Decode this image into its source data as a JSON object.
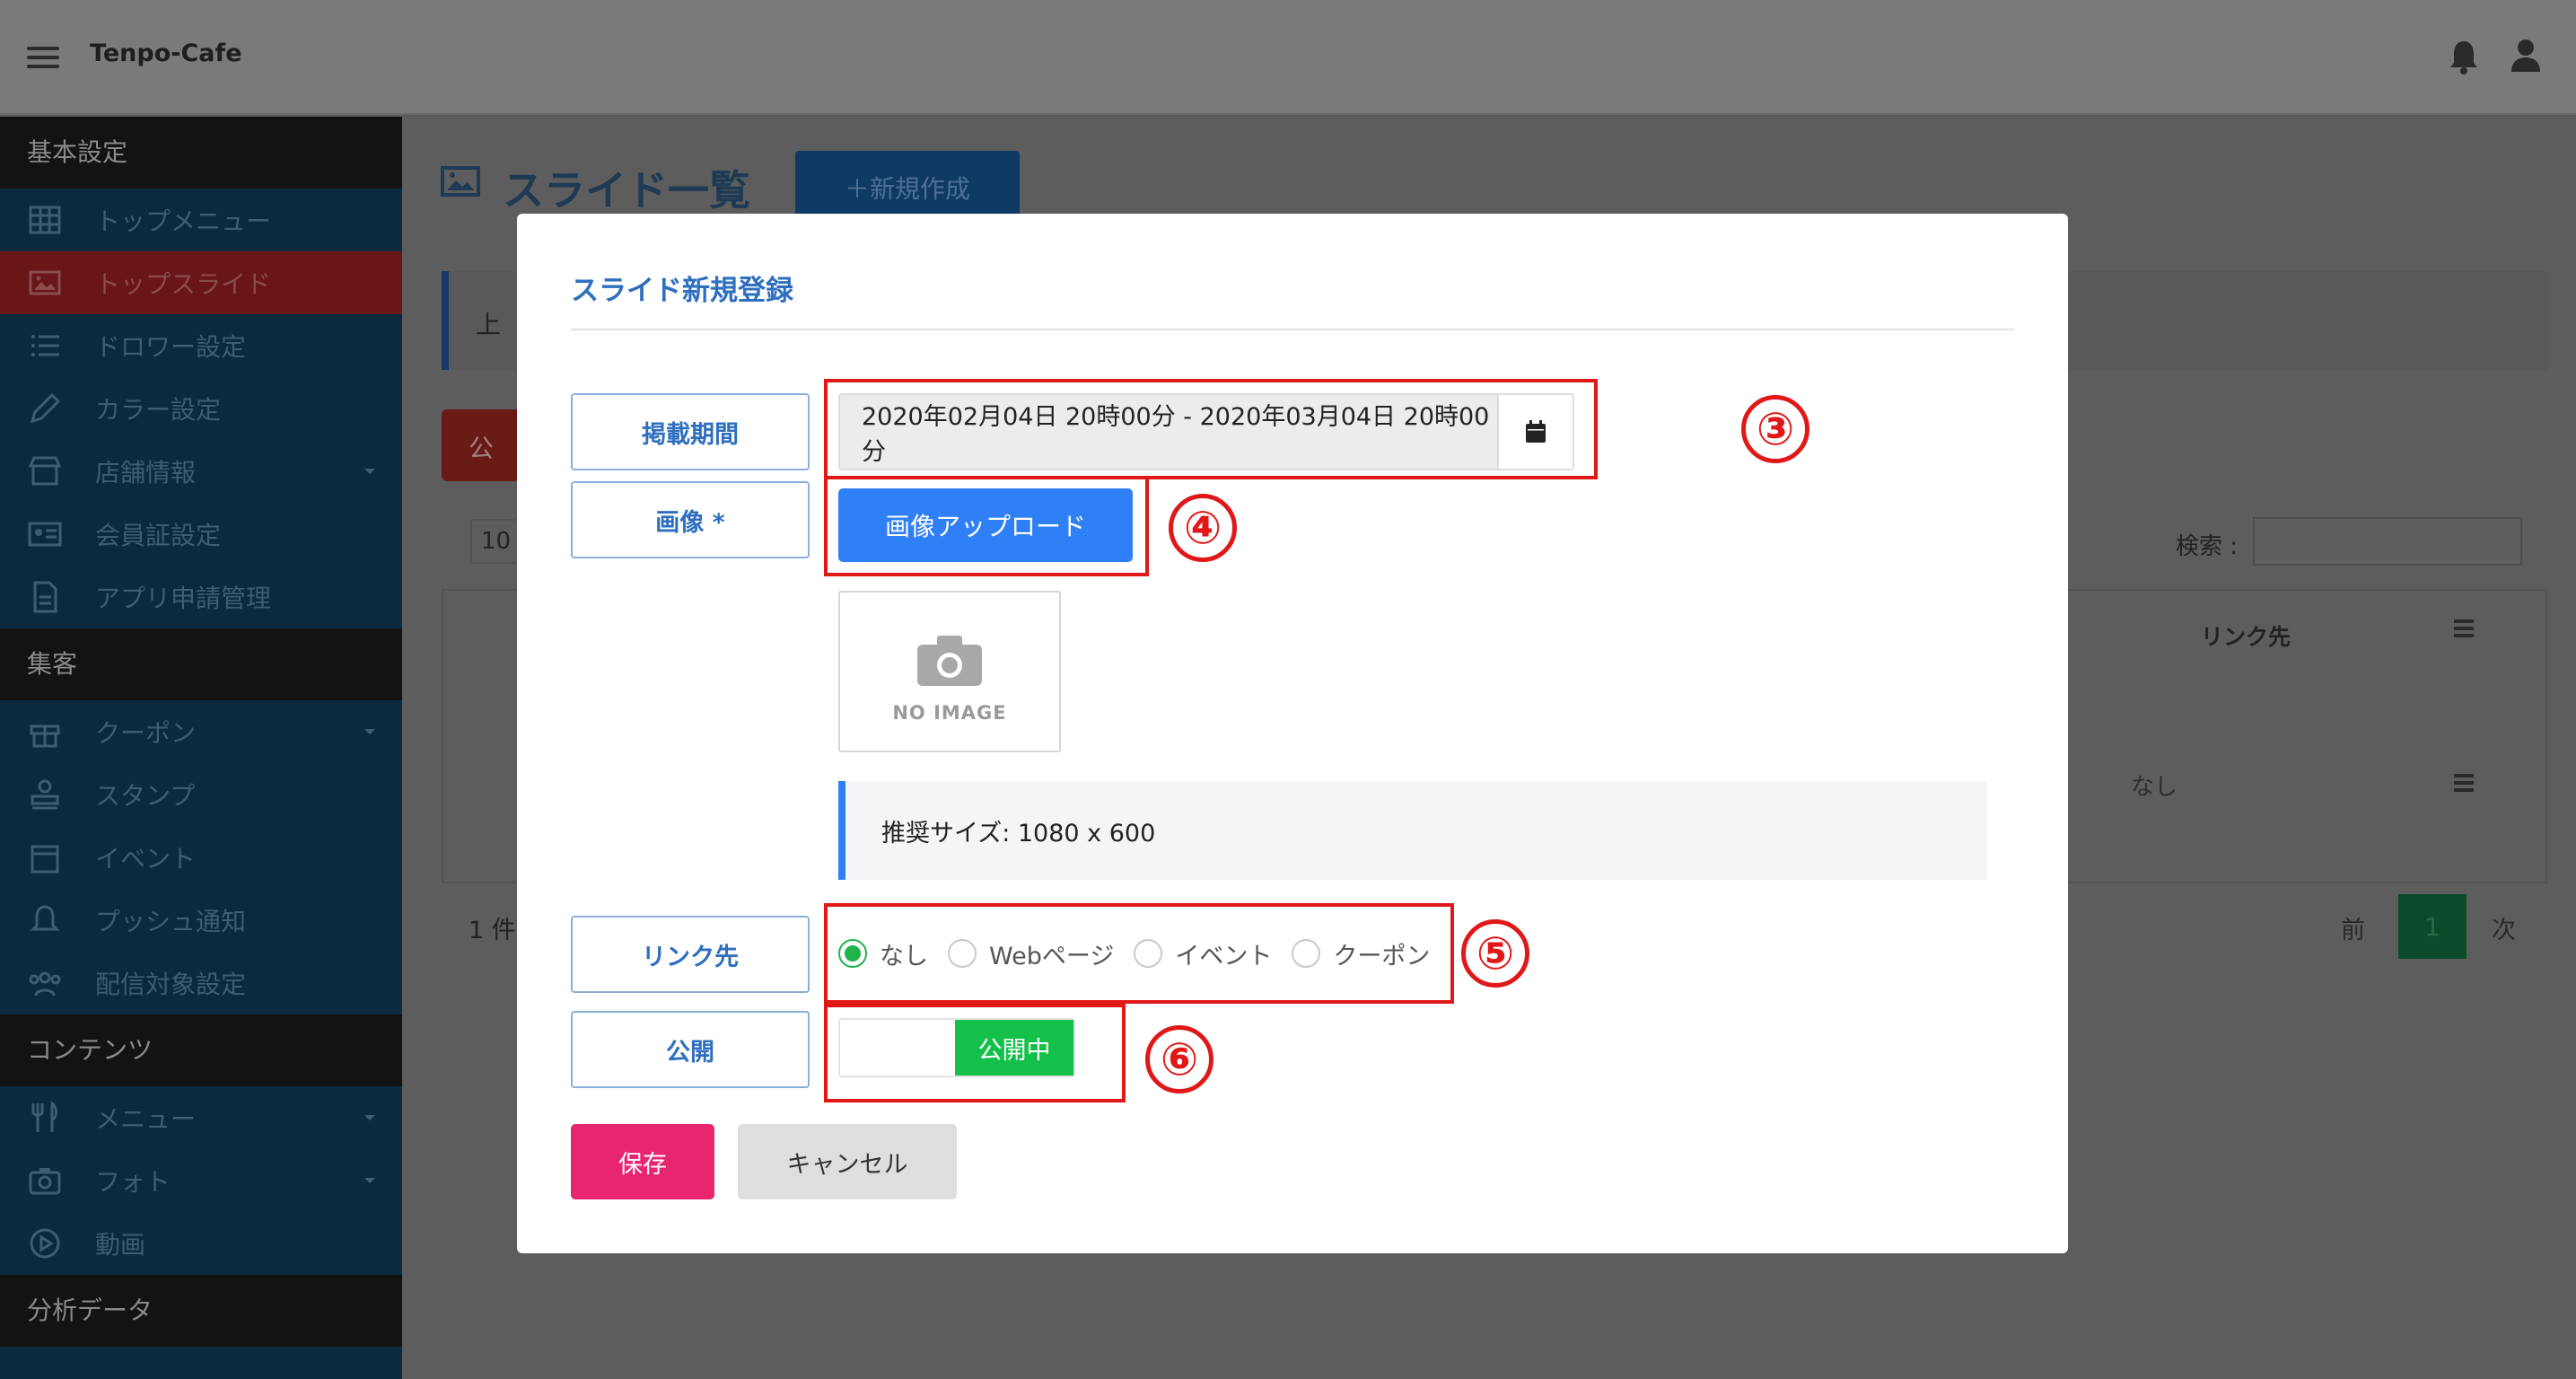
{
  "header": {
    "brand": "Tenpo-Cafe"
  },
  "sidebar": {
    "sections": [
      {
        "title": "基本設定",
        "items": [
          {
            "label": "トップメニュー",
            "icon": "grid-icon"
          },
          {
            "label": "トップスライド",
            "icon": "image-icon",
            "active": true
          },
          {
            "label": "ドロワー設定",
            "icon": "list-icon"
          },
          {
            "label": "カラー設定",
            "icon": "pencil-icon"
          },
          {
            "label": "店舗情報",
            "icon": "store-icon",
            "expandable": true
          },
          {
            "label": "会員証設定",
            "icon": "id-card-icon"
          },
          {
            "label": "アプリ申請管理",
            "icon": "document-icon"
          }
        ]
      },
      {
        "title": "集客",
        "items": [
          {
            "label": "クーポン",
            "icon": "gift-icon",
            "expandable": true
          },
          {
            "label": "スタンプ",
            "icon": "stamp-icon"
          },
          {
            "label": "イベント",
            "icon": "calendar-icon"
          },
          {
            "label": "プッシュ通知",
            "icon": "bell-icon"
          },
          {
            "label": "配信対象設定",
            "icon": "users-icon"
          }
        ]
      },
      {
        "title": "コンテンツ",
        "items": [
          {
            "label": "メニュー",
            "icon": "utensils-icon",
            "expandable": true
          },
          {
            "label": "フォト",
            "icon": "camera-icon",
            "expandable": true
          },
          {
            "label": "動画",
            "icon": "play-icon"
          }
        ]
      },
      {
        "title": "分析データ",
        "items": []
      }
    ]
  },
  "background": {
    "page_title": "スライド一覧",
    "new_button": "＋新規作成",
    "notice_prefix": "上",
    "red_button": "公",
    "page_length": "10",
    "search_label": "検索 :",
    "table_header_link": "リンク先",
    "table_cell_link": "なし",
    "count_text": "1 件",
    "prev": "前",
    "page": "1",
    "next": "次"
  },
  "modal": {
    "title": "スライド新規登録",
    "period_label": "掲載期間",
    "period_value": "2020年02月04日 20時00分 - 2020年03月04日 20時00分",
    "image_label": "画像 *",
    "upload_button": "画像アップロード",
    "no_image_text": "NO IMAGE",
    "recommended_size": "推奨サイズ: 1080 x 600",
    "link_label": "リンク先",
    "link_options": [
      "なし",
      "Webページ",
      "イベント",
      "クーポン"
    ],
    "link_selected": "なし",
    "publish_label": "公開",
    "publish_state": "公開中",
    "save_button": "保存",
    "cancel_button": "キャンセル"
  },
  "annotations": [
    "③",
    "④",
    "⑤",
    "⑥"
  ],
  "colors": {
    "accent_blue": "#2f80f7",
    "label_blue": "#2f6fbf",
    "save_pink": "#e8266f",
    "toggle_green": "#13c04a",
    "radio_green": "#22b24c",
    "annotation_red": "#e01818"
  }
}
